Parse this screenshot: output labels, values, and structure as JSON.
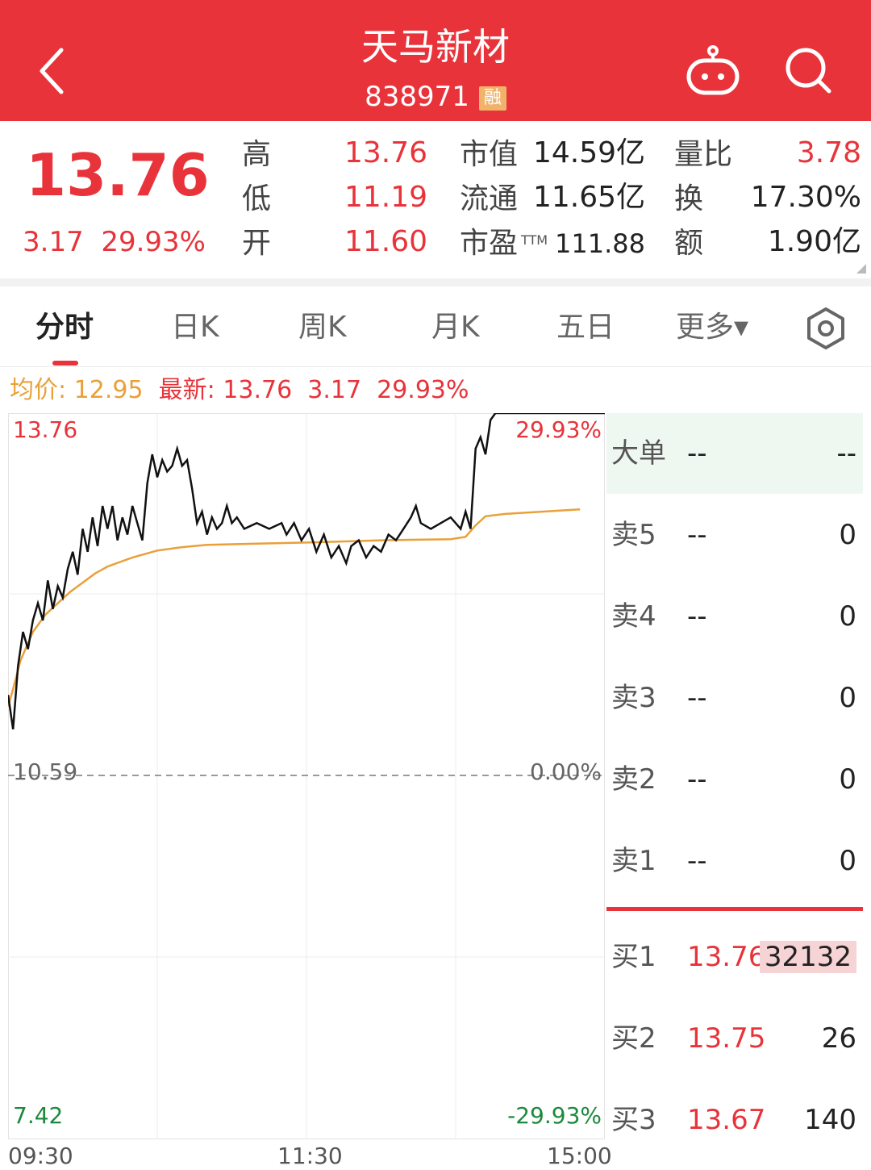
{
  "header": {
    "title": "天马新材",
    "code": "838971",
    "badge": "融",
    "bg_color": "#e8333a"
  },
  "quote": {
    "price": "13.76",
    "change": "3.17",
    "change_pct": "29.93%",
    "high_label": "高",
    "high": "13.76",
    "low_label": "低",
    "low": "11.19",
    "open_label": "开",
    "open": "11.60",
    "mcap_label": "市值",
    "mcap": "14.59亿",
    "float_label": "流通",
    "float": "11.65亿",
    "pe_label": "市盈",
    "pe_sup": "TTM",
    "pe": "111.88",
    "vr_label": "量比",
    "vr": "3.78",
    "turnover_label": "换",
    "turnover": "17.30%",
    "amount_label": "额",
    "amount": "1.90亿"
  },
  "tabs": [
    {
      "label": "分时",
      "active": true
    },
    {
      "label": "日K",
      "active": false
    },
    {
      "label": "周K",
      "active": false
    },
    {
      "label": "月K",
      "active": false
    },
    {
      "label": "五日",
      "active": false
    },
    {
      "label": "更多▾",
      "active": false
    }
  ],
  "icons": {
    "back": "chevron-left-icon",
    "robot": "robot-icon",
    "search": "search-icon",
    "settings": "hexagon-settings-icon"
  },
  "info_line": {
    "avg_label": "均价:",
    "avg": "12.95",
    "latest_label": "最新:",
    "latest": "13.76",
    "change": "3.17",
    "change_pct": "29.93%"
  },
  "chart_data": {
    "type": "line",
    "x_labels": [
      "09:30",
      "11:30",
      "15:00"
    ],
    "y_left_labels": {
      "top": "13.76",
      "mid": "10.59",
      "bottom": "7.42"
    },
    "y_right_labels": {
      "top": "29.93%",
      "mid": "0.00%",
      "bottom": "-29.93%"
    },
    "ylim": [
      7.42,
      13.76
    ],
    "prev_close": 10.59,
    "grid": true,
    "series": [
      {
        "key": "price",
        "color": "#111111",
        "points": [
          [
            0,
            11.3
          ],
          [
            2,
            11.0
          ],
          [
            4,
            11.55
          ],
          [
            6,
            11.85
          ],
          [
            8,
            11.7
          ],
          [
            10,
            11.95
          ],
          [
            12,
            12.1
          ],
          [
            14,
            11.95
          ],
          [
            16,
            12.3
          ],
          [
            18,
            12.05
          ],
          [
            20,
            12.25
          ],
          [
            22,
            12.15
          ],
          [
            24,
            12.4
          ],
          [
            26,
            12.55
          ],
          [
            28,
            12.35
          ],
          [
            30,
            12.75
          ],
          [
            32,
            12.55
          ],
          [
            34,
            12.85
          ],
          [
            36,
            12.6
          ],
          [
            38,
            12.95
          ],
          [
            40,
            12.75
          ],
          [
            42,
            12.95
          ],
          [
            44,
            12.65
          ],
          [
            46,
            12.85
          ],
          [
            48,
            12.7
          ],
          [
            50,
            12.95
          ],
          [
            52,
            12.8
          ],
          [
            54,
            12.65
          ],
          [
            56,
            13.15
          ],
          [
            58,
            13.4
          ],
          [
            60,
            13.2
          ],
          [
            62,
            13.35
          ],
          [
            64,
            13.25
          ],
          [
            66,
            13.3
          ],
          [
            68,
            13.45
          ],
          [
            70,
            13.3
          ],
          [
            72,
            13.35
          ],
          [
            74,
            13.1
          ],
          [
            76,
            12.8
          ],
          [
            78,
            12.9
          ],
          [
            80,
            12.7
          ],
          [
            82,
            12.85
          ],
          [
            84,
            12.75
          ],
          [
            86,
            12.8
          ],
          [
            88,
            12.95
          ],
          [
            90,
            12.8
          ],
          [
            92,
            12.85
          ],
          [
            95,
            12.75
          ],
          [
            100,
            12.8
          ],
          [
            105,
            12.75
          ],
          [
            110,
            12.8
          ],
          [
            112,
            12.7
          ],
          [
            115,
            12.8
          ],
          [
            118,
            12.65
          ],
          [
            121,
            12.75
          ],
          [
            124,
            12.55
          ],
          [
            127,
            12.7
          ],
          [
            130,
            12.5
          ],
          [
            133,
            12.6
          ],
          [
            136,
            12.45
          ],
          [
            138,
            12.6
          ],
          [
            141,
            12.65
          ],
          [
            144,
            12.5
          ],
          [
            147,
            12.6
          ],
          [
            150,
            12.55
          ],
          [
            153,
            12.7
          ],
          [
            156,
            12.65
          ],
          [
            159,
            12.75
          ],
          [
            162,
            12.85
          ],
          [
            164,
            12.95
          ],
          [
            166,
            12.8
          ],
          [
            170,
            12.75
          ],
          [
            174,
            12.8
          ],
          [
            178,
            12.85
          ],
          [
            182,
            12.75
          ],
          [
            184,
            12.9
          ],
          [
            186,
            12.75
          ],
          [
            188,
            13.45
          ],
          [
            190,
            13.55
          ],
          [
            192,
            13.4
          ],
          [
            194,
            13.7
          ],
          [
            196,
            13.76
          ],
          [
            200,
            13.76
          ],
          [
            240,
            13.76
          ]
        ]
      },
      {
        "key": "avg",
        "color": "#e9a03a",
        "points": [
          [
            0,
            11.2
          ],
          [
            2,
            11.35
          ],
          [
            5,
            11.6
          ],
          [
            10,
            11.85
          ],
          [
            15,
            12.0
          ],
          [
            20,
            12.1
          ],
          [
            25,
            12.2
          ],
          [
            30,
            12.28
          ],
          [
            35,
            12.36
          ],
          [
            40,
            12.42
          ],
          [
            45,
            12.46
          ],
          [
            50,
            12.5
          ],
          [
            60,
            12.56
          ],
          [
            70,
            12.59
          ],
          [
            80,
            12.61
          ],
          [
            100,
            12.62
          ],
          [
            120,
            12.63
          ],
          [
            150,
            12.65
          ],
          [
            178,
            12.66
          ],
          [
            184,
            12.68
          ],
          [
            188,
            12.78
          ],
          [
            192,
            12.86
          ],
          [
            200,
            12.88
          ],
          [
            230,
            12.92
          ],
          [
            260,
            12.94
          ],
          [
            300,
            12.95
          ],
          [
            360,
            12.96
          ]
        ]
      }
    ]
  },
  "order_book": {
    "big_order": {
      "label": "大单",
      "price": "--",
      "vol": "--"
    },
    "asks": [
      {
        "label": "卖5",
        "price": "--",
        "vol": "0"
      },
      {
        "label": "卖4",
        "price": "--",
        "vol": "0"
      },
      {
        "label": "卖3",
        "price": "--",
        "vol": "0"
      },
      {
        "label": "卖2",
        "price": "--",
        "vol": "0"
      },
      {
        "label": "卖1",
        "price": "--",
        "vol": "0"
      }
    ],
    "bids": [
      {
        "label": "买1",
        "price": "13.76",
        "vol": "32132"
      },
      {
        "label": "买2",
        "price": "13.75",
        "vol": "26"
      },
      {
        "label": "买3",
        "price": "13.67",
        "vol": "140"
      }
    ]
  }
}
